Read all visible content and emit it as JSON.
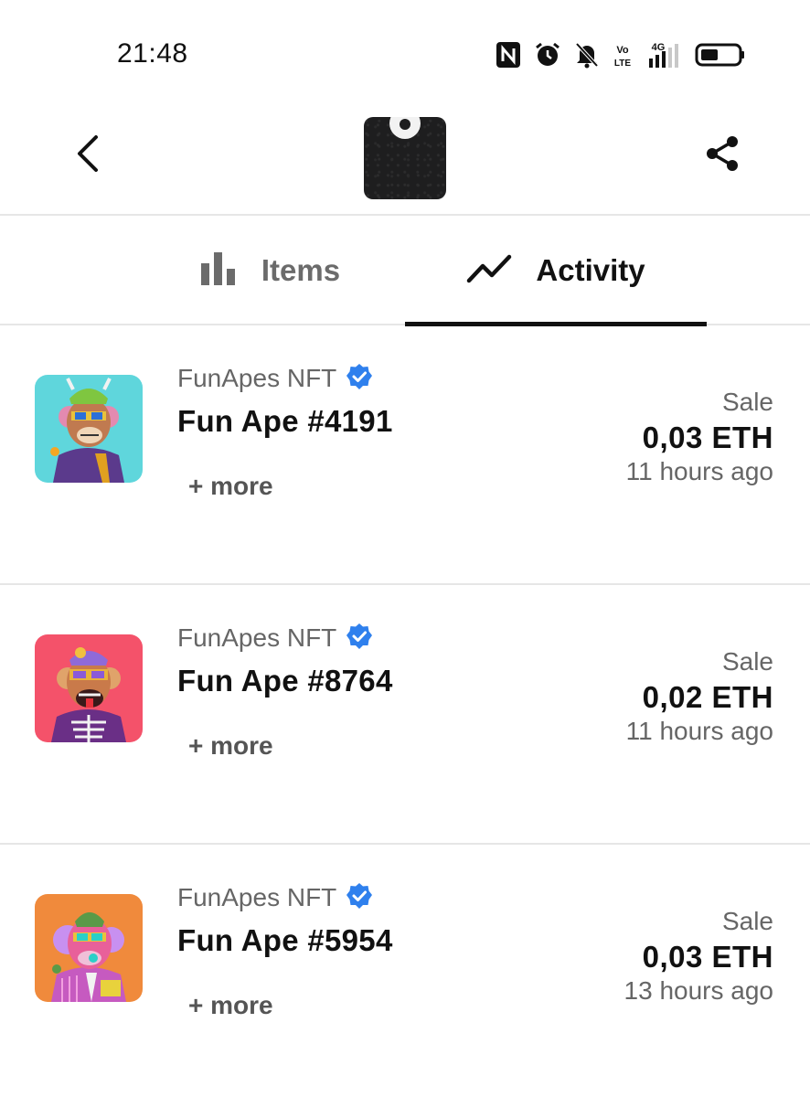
{
  "status_bar": {
    "time": "21:48",
    "icons": [
      "nfc-icon",
      "alarm-icon",
      "mute-bell-icon",
      "volte-icon",
      "signal-4g-icon",
      "battery-icon"
    ]
  },
  "header": {
    "back_icon": "chevron-left-icon",
    "share_icon": "share-icon"
  },
  "tabs": [
    {
      "label": "Items",
      "icon": "bar-chart-icon",
      "active": false
    },
    {
      "label": "Activity",
      "icon": "trend-line-icon",
      "active": true
    }
  ],
  "activity": [
    {
      "collection": "FunApes NFT",
      "item": "Fun Ape #4191",
      "more": "+ more",
      "event": "Sale",
      "price": "0,03 ETH",
      "time": "11 hours ago",
      "bg": "#5fd6dc"
    },
    {
      "collection": "FunApes NFT",
      "item": "Fun Ape #8764",
      "more": "+ more",
      "event": "Sale",
      "price": "0,02 ETH",
      "time": "11 hours ago",
      "bg": "#f4526a"
    },
    {
      "collection": "FunApes NFT",
      "item": "Fun Ape #5954",
      "more": "+ more",
      "event": "Sale",
      "price": "0,03 ETH",
      "time": "13 hours ago",
      "bg": "#f08a3c"
    }
  ],
  "colors": {
    "verified": "#2f80ed",
    "active_tab": "#111111",
    "inactive_tab": "#6b6b6b",
    "divider": "#e6e6e6"
  }
}
